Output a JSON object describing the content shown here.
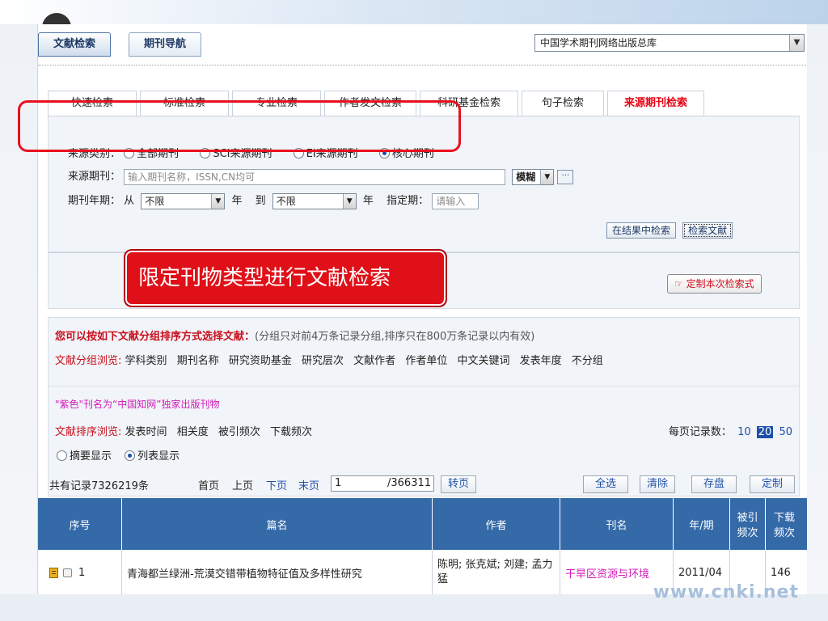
{
  "top_tabs": [
    "文献检索",
    "期刊导航"
  ],
  "database_select": "中国学术期刊网络出版总库",
  "search_tabs": [
    "快速检索",
    "标准检索",
    "专业检索",
    "作者发文检索",
    "科研基金检索",
    "句子检索",
    "来源期刊检索"
  ],
  "active_search_tab": "来源期刊检索",
  "source_type": {
    "label": "来源类别：",
    "options": [
      "全部期刊",
      "SCI来源期刊",
      "EI来源期刊",
      "核心期刊"
    ],
    "selected": "核心期刊"
  },
  "source_journal": {
    "label": "来源期刊：",
    "placeholder": "输入期刊名称，ISSN,CN均可",
    "match_mode": "模糊",
    "more_button": "···"
  },
  "year_period": {
    "label": "期刊年期：",
    "from_label": "从",
    "from_value": "不限",
    "year_label": "年",
    "to_label": "到",
    "to_value": "不限",
    "year_label2": "年",
    "specify_label": "指定期：",
    "specify_placeholder": "请输入"
  },
  "buttons": {
    "search_in_results": "在结果中检索",
    "search_documents": "检索文献",
    "customize": "定制本次检索式"
  },
  "callout_label": "限定刊物类型进行文献检索",
  "grouping": {
    "title": "您可以按如下文献分组排序方式选择文献：",
    "note": "(分组只对前4万条记录分组,排序只在800万条记录以内有效)",
    "browse_label": "文献分组浏览:",
    "browse_options": [
      "学科类别",
      "期刊名称",
      "研究资助基金",
      "研究层次",
      "文献作者",
      "作者单位",
      "中文关键词",
      "发表年度",
      "不分组"
    ],
    "exclusive_note": "\"紫色\"刊名为“中国知网”独家出版刊物",
    "sort_label": "文献排序浏览:",
    "sort_options": [
      "发表时间",
      "相关度",
      "被引频次",
      "下载频次"
    ],
    "per_page_label": "每页记录数：",
    "per_page_options": [
      "10",
      "20",
      "50"
    ],
    "per_page_selected": "20",
    "display_modes": [
      "摘要显示",
      "列表显示"
    ],
    "display_selected": "列表显示"
  },
  "pager": {
    "total": "共有记录7326219条",
    "first": "首页",
    "prev": "上页",
    "next": "下页",
    "last": "末页",
    "page_value": "1",
    "total_pages": "/366311",
    "go": "转页",
    "select_all": "全选",
    "clear": "清除",
    "save": "存盘",
    "custom": "定制"
  },
  "table": {
    "headers": [
      "序号",
      "篇名",
      "作者",
      "刊名",
      "年/期",
      "被引频次",
      "下载频次"
    ],
    "rows": [
      {
        "index": "1",
        "title": "青海都兰绿洲-荒漠交错带植物特征值及多样性研究",
        "authors": "陈明; 张克斌; 刘建; 孟力猛",
        "journal": "干旱区资源与环境",
        "issue": "2011/04",
        "cited": "",
        "downloads": "146"
      }
    ]
  },
  "watermark": "www.cnki.net"
}
